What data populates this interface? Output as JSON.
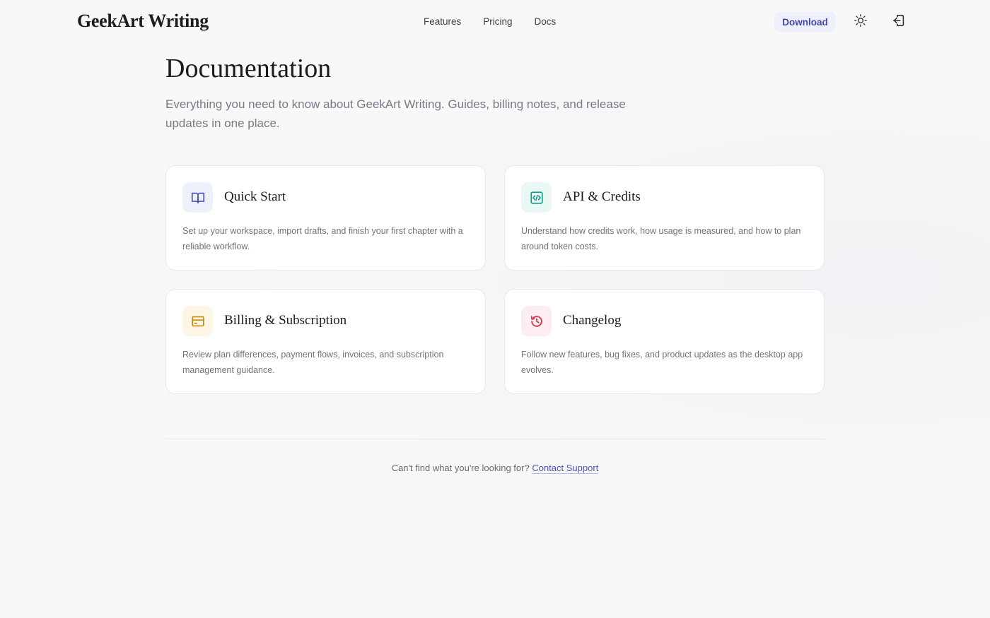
{
  "header": {
    "logo": "GeekArt Writing",
    "nav": {
      "features": "Features",
      "pricing": "Pricing",
      "docs": "Docs"
    },
    "download_label": "Download",
    "theme_icon": "sun-icon",
    "login_icon": "sign-in-icon"
  },
  "hero": {
    "title": "Documentation",
    "subtitle": "Everything you need to know about GeekArt Writing. Guides, billing notes, and release updates in one place."
  },
  "cards": [
    {
      "title": "Quick Start",
      "description": "Set up your workspace, import drafts, and finish your first chapter with a reliable workflow.",
      "icon": "book-open-icon",
      "accent": "#4b4fb0"
    },
    {
      "title": "API & Credits",
      "description": "Understand how credits work, how usage is measured, and how to plan around token costs.",
      "icon": "code-file-icon",
      "accent": "#169b8c"
    },
    {
      "title": "Billing & Subscription",
      "description": "Review plan differences, payment flows, invoices, and subscription management guidance.",
      "icon": "credit-card-icon",
      "accent": "#c58a12"
    },
    {
      "title": "Changelog",
      "description": "Follow new features, bug fixes, and product updates as the desktop app evolves.",
      "icon": "history-icon",
      "accent": "#d2334f"
    }
  ],
  "footer": {
    "prompt": "Can't find what you're looking for?",
    "link": "Contact Support"
  },
  "colors": {
    "background": "#f8f8f9",
    "brand": "#4347a8",
    "card_border": "#e8e8ec"
  }
}
